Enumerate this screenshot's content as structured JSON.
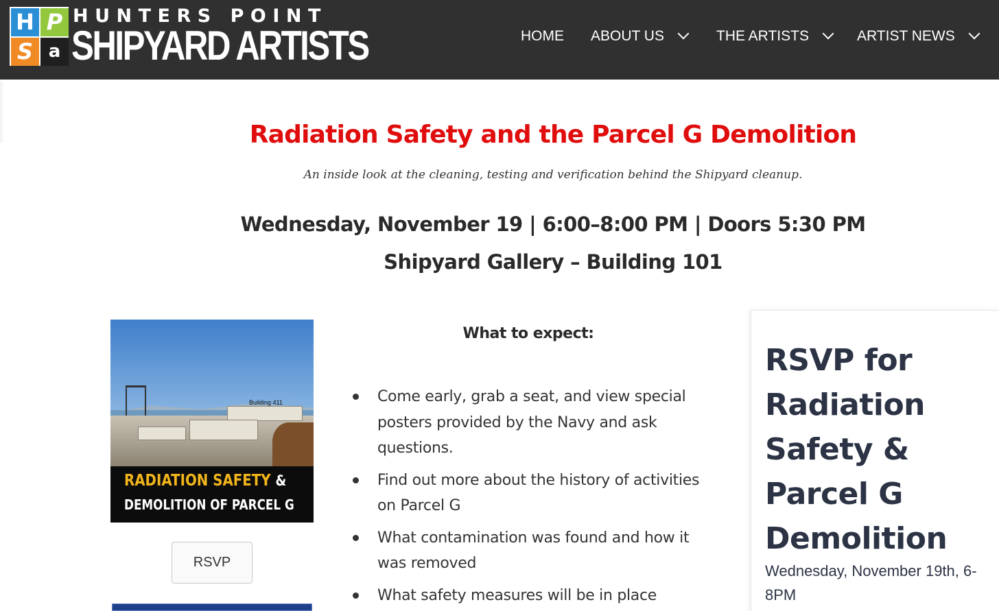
{
  "header": {
    "logo": {
      "tiles": [
        "H",
        "P",
        "S",
        "a"
      ],
      "line1": "HUNTERS POINT",
      "line2": "SHIPYARD ARTISTS"
    },
    "nav": [
      {
        "label": "HOME",
        "dropdown": false
      },
      {
        "label": "ABOUT US",
        "dropdown": true
      },
      {
        "label": "THE ARTISTS",
        "dropdown": true
      },
      {
        "label": "ARTIST NEWS",
        "dropdown": true
      }
    ]
  },
  "event": {
    "title": "Radiation Safety and the Parcel G Demolition",
    "subtitle": "An inside look at the cleaning, testing and verification behind the Shipyard cleanup.",
    "when": "Wednesday, November 19 | 6:00–8:00 PM | Doors 5:30 PM",
    "where": "Shipyard Gallery – Building 101"
  },
  "poster": {
    "building_label": "Building 411",
    "line1": "RADIATION SAFETY",
    "line1_amp": "&",
    "line2": "DEMOLITION OF PARCEL G"
  },
  "rsvp_button": "RSVP",
  "expect": {
    "heading": "What to expect:",
    "items": [
      "Come early, grab a seat, and view special posters provided by the Navy and ask questions.",
      "Find out more about the history of activities on Parcel G",
      "What contamination was found and how it was removed",
      "What safety measures will be in place"
    ]
  },
  "sidebar": {
    "heading": "RSVP for Radiation Safety & Parcel G Demolition",
    "date": "Wednesday, November 19th, 6-8PM"
  },
  "colors": {
    "header_bg": "#303030",
    "title_red": "#e00d0d",
    "poster_yellow": "#f2b51c",
    "sidebar_text": "#2c3345"
  }
}
